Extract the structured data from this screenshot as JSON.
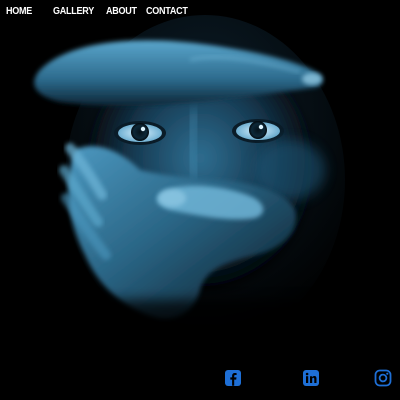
{
  "nav": {
    "home": "HOME",
    "gallery": "GALLERY",
    "about": "ABOUT",
    "contact": "CONTACT"
  },
  "hero": {
    "subject": "face-covered-by-hands"
  },
  "social": {
    "icons": [
      "facebook-icon",
      "linkedin-icon",
      "instagram-icon"
    ],
    "color": "#1e6fd6"
  },
  "colors": {
    "background": "#000000",
    "tint": "#2f8fc0",
    "nav_text": "#ffffff"
  }
}
